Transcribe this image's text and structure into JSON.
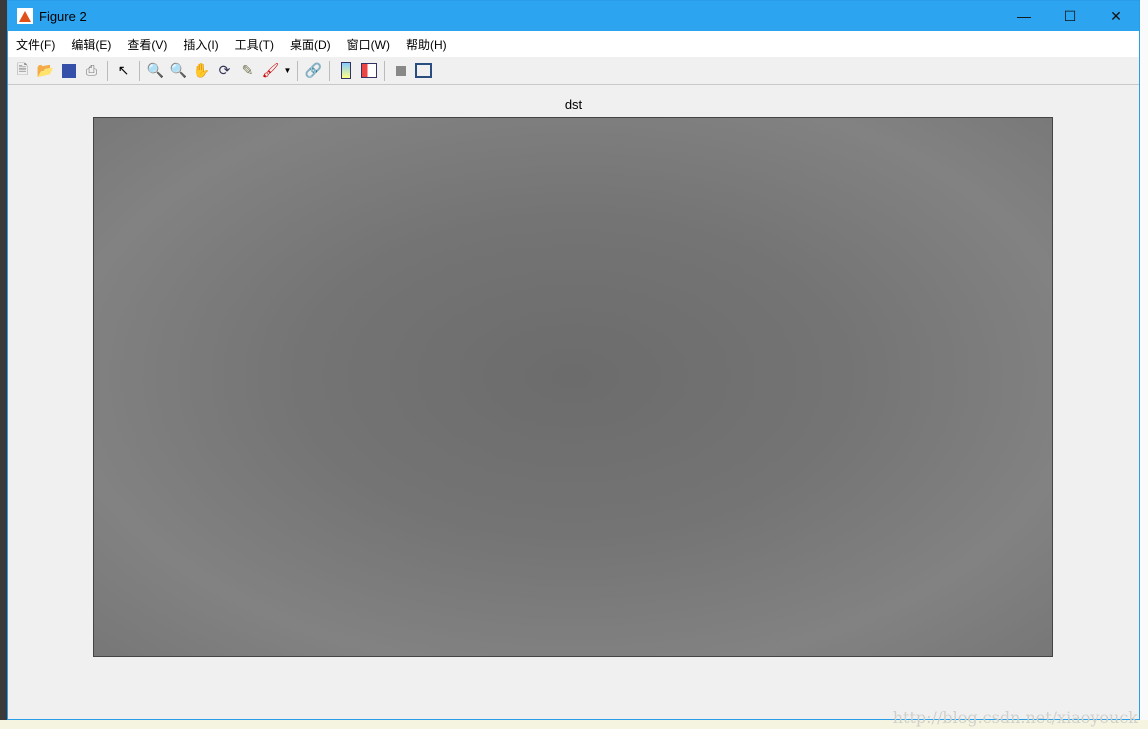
{
  "window": {
    "title": "Figure 2"
  },
  "menu": [
    "文件(F)",
    "编辑(E)",
    "查看(V)",
    "插入(I)",
    "工具(T)",
    "桌面(D)",
    "窗口(W)",
    "帮助(H)"
  ],
  "toolbar": [
    "new-figure",
    "open",
    "save",
    "print",
    "select",
    "zoom-in",
    "zoom-out",
    "pan",
    "rotate-3d",
    "data-cursor",
    "brush",
    "link",
    "colorbar",
    "legend",
    "hide-plot-tools",
    "show-plot-tools"
  ],
  "plot": {
    "title": "dst"
  },
  "watermark": "http://blog.csdn.net/xiaoyouck"
}
